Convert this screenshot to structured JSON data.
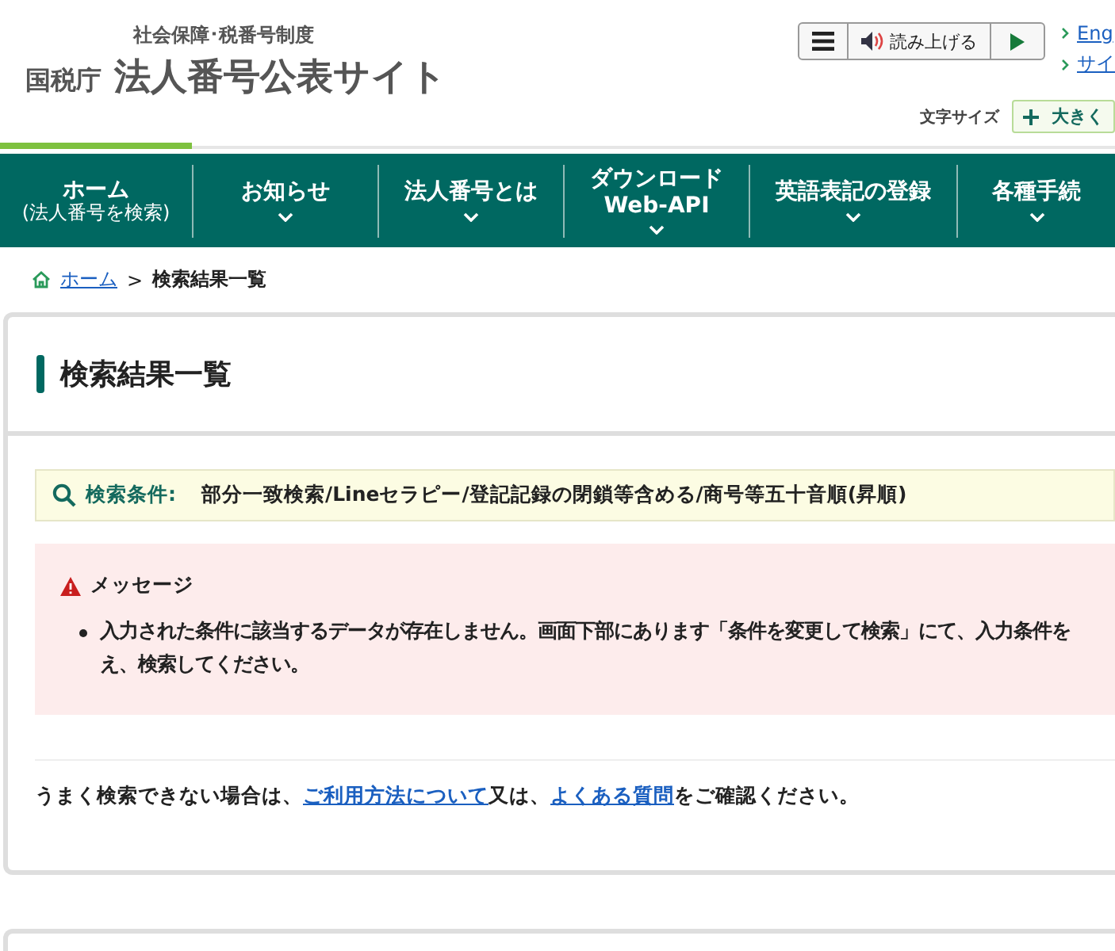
{
  "header": {
    "system": "社会保障･税番号制度",
    "agency": "国税庁",
    "site_title": "法人番号公表サイト"
  },
  "toolbar": {
    "read_aloud": "読み上げる"
  },
  "top_links": [
    "Eng",
    "サイ"
  ],
  "font_size": {
    "label": "文字サイズ",
    "button": "大きく"
  },
  "nav": [
    {
      "lines": [
        "ホーム",
        "(法人番号を検索)"
      ],
      "dropdown": false,
      "selected": true
    },
    {
      "lines": [
        "お知らせ"
      ],
      "dropdown": true,
      "selected": false
    },
    {
      "lines": [
        "法人番号とは"
      ],
      "dropdown": true,
      "selected": false
    },
    {
      "lines": [
        "ダウンロード",
        "Web-API"
      ],
      "dropdown": true,
      "selected": false
    },
    {
      "lines": [
        "英語表記の登録"
      ],
      "dropdown": true,
      "selected": false
    },
    {
      "lines": [
        "各種手続"
      ],
      "dropdown": true,
      "selected": false
    }
  ],
  "breadcrumb": {
    "home": "ホーム",
    "separator": ">",
    "current": "検索結果一覧"
  },
  "page_title": "検索結果一覧",
  "conditions": {
    "label": "検索条件:",
    "value": "部分一致検索/Lineセラピー/登記記録の閉鎖等含める/商号等五十音順(昇順)"
  },
  "message": {
    "title": "メッセージ",
    "lines": [
      "入力された条件に該当するデータが存在しません。画面下部にあります「条件を変更して検索」にて、入力条件を",
      "え、検索してください。"
    ]
  },
  "help": {
    "before": "うまく検索できない場合は、",
    "link1": "ご利用方法について",
    "middle": "又は、",
    "link2": "よくある質問",
    "after": "をご確認ください。"
  }
}
